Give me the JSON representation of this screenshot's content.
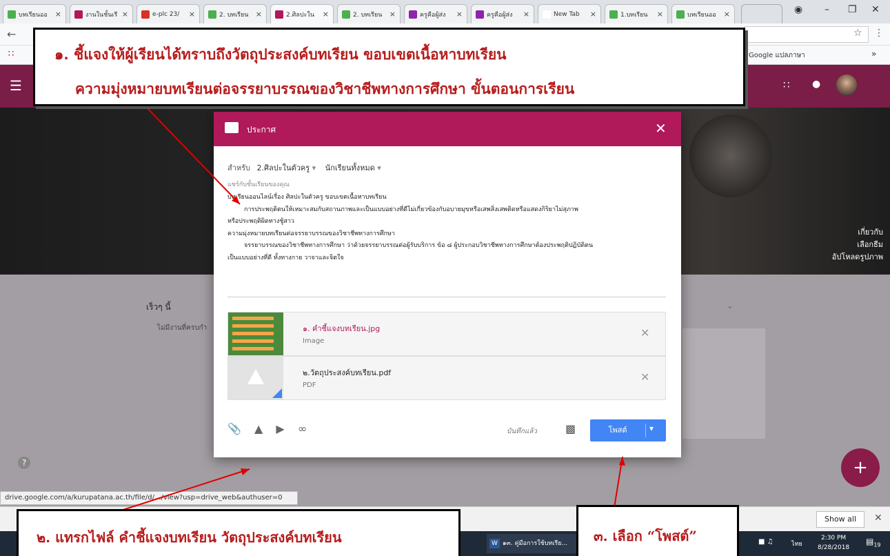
{
  "tabs": [
    {
      "label": "บทเรียนออ",
      "color": "#4caf50"
    },
    {
      "label": "งานในชั้นเรี",
      "color": "#b0195a"
    },
    {
      "label": "e-plc 23/",
      "color": "#d93025"
    },
    {
      "label": "2. บทเรียน",
      "color": "#4caf50"
    },
    {
      "label": "2.ศิลปะใน",
      "color": "#b0195a"
    },
    {
      "label": "2. บทเรียน",
      "color": "#4caf50"
    },
    {
      "label": "ครูคือผู้ส่ง",
      "color": "#8e24aa"
    },
    {
      "label": "ครูคือผู้ส่ง",
      "color": "#8e24aa"
    },
    {
      "label": "New Tab",
      "color": "#ffffff"
    },
    {
      "label": "1.บทเรียน",
      "color": "#4caf50"
    },
    {
      "label": "บทเรียนออ",
      "color": "#4caf50"
    }
  ],
  "bookmarks": {
    "translate": "Google แปลภาษา",
    "more": "»"
  },
  "banner_menu": [
    "เกี่ยวกับ",
    "เลือกธีม",
    "อัปโหลดรูปภาพ"
  ],
  "stream": {
    "upcoming_title": "เร็วๆ นี้",
    "upcoming_empty": "ไม่มีงานที่ครบกำ"
  },
  "modal": {
    "title": "ประกาศ",
    "for_label": "สำหรับ",
    "class_name": "2.ศิลปะในตัวครู",
    "audience": "นักเรียนทั้งหมด",
    "placeholder": "แชร์กับชั้นเรียนของคุณ",
    "body": [
      "บทเรียนออนไลน์เรื่อง ศิลปะในตัวครู ขอบเขตเนื้อหาบทเรียน",
      "การประพฤติตนให้เหมาะสมกับสถานภาพและเป็นแบบอย่างที่ดีไม่เกี่ยวข้องกับอบายมุขหรือเสพสิ่งเสพติดหรือแสดงกิริยาไม่สุภาพ",
      "หรือประพฤติผิดทางชู้สาว",
      "ความมุ่งหมายบทเรียนต่อจรรยาบรรณของวิชาชีพทางการศึกษา",
      "จรรยาบรรณของวิชาชีพทางการศึกษา ว่าด้วยจรรยาบรรณต่อผู้รับบริการ ข้อ ๘ ผู้ประกอบวิชาชีพทางการศึกษาต้องประพฤติปฏิบัติตน",
      "เป็นแบบอย่างที่ดี ทั้งทางกาย วาจาและจิตใจ"
    ],
    "attachments": [
      {
        "name": "๑. คำชี้แจงบทเรียน.jpg",
        "type": "Image"
      },
      {
        "name": "๒.วัตถุประสงค์บทเรียน.pdf",
        "type": "PDF"
      }
    ],
    "saved": "บันทึกแล้ว",
    "post": "โพสต์"
  },
  "status_url": "drive.google.com/a/kurupatana.ac.th/file/d/.../view?usp=drive_web&authuser=0",
  "callouts": {
    "top_line1": "๑. ชี้แจงให้ผู้เรียนได้ทราบถึงวัตถุประสงค์บทเรียน ขอบเขตเนื้อหาบทเรียน",
    "top_line2": "ความมุ่งหมายบทเรียนต่อจรรยาบรรณของวิชาชีพทางการศึกษา ขั้นตอนการเรียน",
    "bottom_left": "๒. แทรกไฟล์ คำชี้แจงบทเรียน วัตถุประสงค์บทเรียน",
    "bottom_right": "๓. เลือก “โพสต์”"
  },
  "download_bar": {
    "show_all": "Show all"
  },
  "taskbar": {
    "word_doc": "๑๓. คู่มือการใช้บทเรีย...",
    "time": "2:30 PM",
    "date": "8/28/2018",
    "lang": "ไทย",
    "notif": "19"
  }
}
